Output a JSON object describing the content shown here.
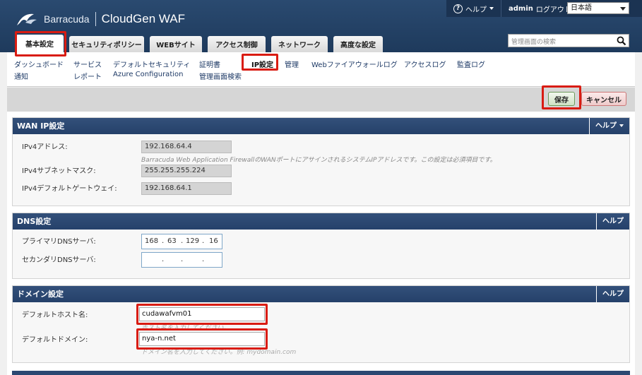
{
  "brand": {
    "company": "Barracuda",
    "product": "CloudGen WAF"
  },
  "topbar": {
    "help": "ヘルプ",
    "user": "admin",
    "logout": "ログアウト",
    "language": "日本語"
  },
  "search": {
    "placeholder": "管理画面の検索"
  },
  "tabs": [
    {
      "label": "基本設定"
    },
    {
      "label": "セキュリティポリシー"
    },
    {
      "label": "WEBサイト"
    },
    {
      "label": "アクセス制御"
    },
    {
      "label": "ネットワーク"
    },
    {
      "label": "高度な設定"
    }
  ],
  "subnav": [
    {
      "label": "ダッシュボード"
    },
    {
      "label": "通知"
    },
    {
      "label": "サービス"
    },
    {
      "label": "レポート"
    },
    {
      "label": "デフォルトセキュリティ"
    },
    {
      "label": "Azure Configuration"
    },
    {
      "label": "証明書"
    },
    {
      "label": "管理画面検索"
    },
    {
      "label": "IP設定"
    },
    {
      "label": "管理"
    },
    {
      "label": "Webファイアウォールログ"
    },
    {
      "label": "アクセスログ"
    },
    {
      "label": "監査ログ"
    }
  ],
  "actions": {
    "save": "保存",
    "cancel": "キャンセル"
  },
  "wan": {
    "title": "WAN IP設定",
    "help": "ヘルプ",
    "ipv4_label": "IPv4アドレス:",
    "ipv4_value": "192.168.64.4",
    "ipv4_desc": "Barracuda Web Application FirewallのWANポートにアサインされるシステムIPアドレスです。この設定は必須項目です。",
    "mask_label": "IPv4サブネットマスク:",
    "mask_value": "255.255.255.224",
    "gw_label": "IPv4デフォルトゲートウェイ:",
    "gw_value": "192.168.64.1"
  },
  "dns": {
    "title": "DNS設定",
    "help": "ヘルプ",
    "primary_label": "プライマリDNSサーバ:",
    "primary_octets": [
      "168",
      "63",
      "129",
      "16"
    ],
    "secondary_label": "セカンダリDNSサーバ:",
    "dot": "."
  },
  "domain": {
    "title": "ドメイン設定",
    "help": "ヘルプ",
    "host_label": "デフォルトホスト名:",
    "host_value": "cudawafvm01",
    "host_desc": "ホスト名を入力してください。",
    "domain_label": "デフォルトドメイン:",
    "domain_value": "nya-n.net",
    "domain_desc": "ドメイン名を入力してください。例: mydomain.com"
  }
}
